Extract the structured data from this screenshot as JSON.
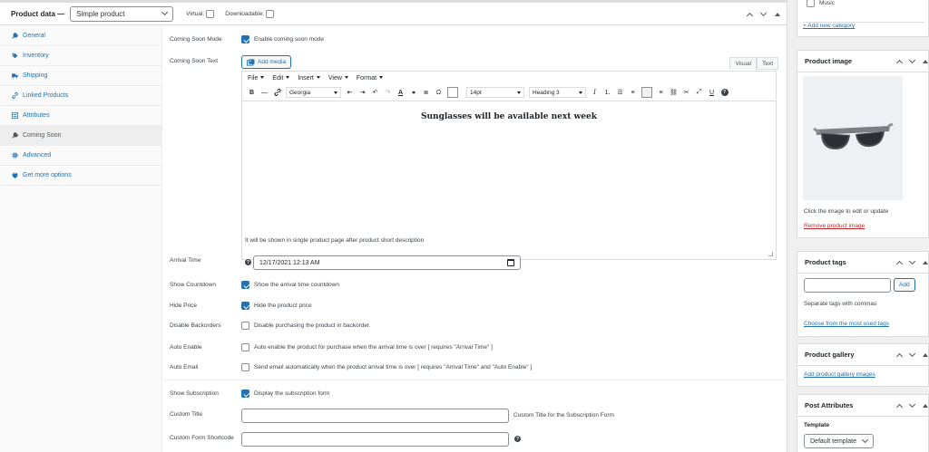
{
  "header": {
    "title": "Product data —",
    "product_type": "Simple product",
    "virtual_label": "Virtual:",
    "downloadable_label": "Downloadable:"
  },
  "tabs": [
    {
      "label": "General",
      "icon": "wrench-icon",
      "active": false
    },
    {
      "label": "Inventory",
      "icon": "tag-icon",
      "active": false
    },
    {
      "label": "Shipping",
      "icon": "truck-icon",
      "active": false
    },
    {
      "label": "Linked Products",
      "icon": "link-icon",
      "active": false
    },
    {
      "label": "Attributes",
      "icon": "list-icon",
      "active": false
    },
    {
      "label": "Coming Soon",
      "icon": "wrench-icon",
      "active": true
    },
    {
      "label": "Advanced",
      "icon": "gear-icon",
      "active": false
    },
    {
      "label": "Get more options",
      "icon": "plugin-icon",
      "active": false
    }
  ],
  "panel": {
    "coming_soon_mode": {
      "label": "Coming Soon Mode",
      "text": "Enable coming soon mode",
      "checked": true
    },
    "coming_soon_text": {
      "label": "Coming Soon Text",
      "add_media": "Add media",
      "tab_visual": "Visual",
      "tab_text": "Text"
    },
    "editor": {
      "menus": [
        "File",
        "Edit",
        "Insert",
        "View",
        "Format"
      ],
      "font": "Georgia",
      "size": "14pt",
      "block": "Heading 3",
      "content": "Sunglasses will be available next week"
    },
    "editor_hint": "It will be shown in single product page after product short description",
    "arrival_time": {
      "label": "Arrival Time",
      "value": "12/17/2021 12:13 AM"
    },
    "show_countdown": {
      "label": "Show Countdown",
      "text": "Show the arrival time countdown",
      "checked": true
    },
    "hide_price": {
      "label": "Hide Price",
      "text": "Hide the product price",
      "checked": true
    },
    "disable_backorders": {
      "label": "Disable Backorders",
      "text": "Disable purchasing the product in backorder.",
      "checked": false
    },
    "auto_enable": {
      "label": "Auto Enable",
      "text": "Auto enable the product for purchase when the arrival time is over [ requires \"Arrival Time\" ]",
      "checked": false
    },
    "auto_email": {
      "label": "Auto Email",
      "text": "Send email automatically when the product arrival time is over [ requires \"Arrival Time\" and \"Auto Enable\" ]",
      "checked": false
    },
    "show_subscription": {
      "label": "Show Subscription",
      "text": "Display the subscription form",
      "checked": true
    },
    "custom_title": {
      "label": "Custom Title",
      "value": "",
      "desc": "Custom Title for the Subscription Form"
    },
    "custom_shortcode": {
      "label": "Custom Form Shortcode",
      "value": ""
    }
  },
  "sidebar": {
    "categories": {
      "item": "Music",
      "add_link": "+ Add new category"
    },
    "product_image": {
      "title": "Product image",
      "hint": "Click the image to edit or update",
      "remove_link": "Remove product image"
    },
    "product_tags": {
      "title": "Product tags",
      "add_button": "Add",
      "hint": "Separate tags with commas",
      "choose_link": "Choose from the most used tags"
    },
    "product_gallery": {
      "title": "Product gallery",
      "add_link": "Add product gallery images"
    },
    "post_attributes": {
      "title": "Post Attributes",
      "template_label": "Template",
      "template_value": "Default template"
    }
  },
  "colors": {
    "accent": "#2271b1",
    "danger": "#b32d2e",
    "border": "#dcdcde"
  }
}
